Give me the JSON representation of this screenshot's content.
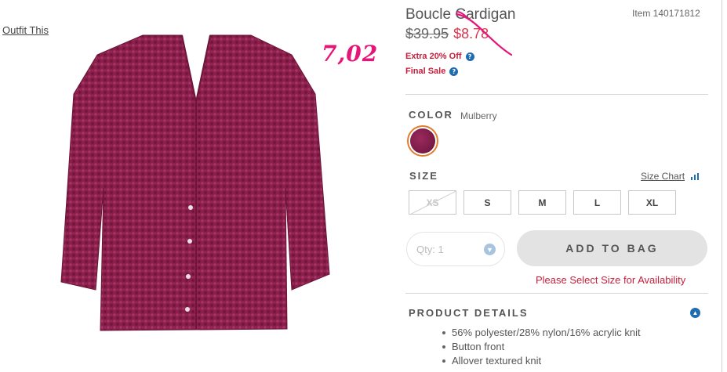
{
  "links": {
    "outfit": "Outfit This"
  },
  "annotation": {
    "handwritten_price": "7,02"
  },
  "product": {
    "title": "Boucle Cardigan",
    "item_number": "Item 140171812",
    "price_original": "$39.95",
    "price_sale": "$8.78",
    "promo_extra": "Extra 20% Off",
    "promo_final": "Final Sale"
  },
  "color": {
    "label": "COLOR",
    "value": "Mulberry",
    "swatch_hex": "#7d1c48"
  },
  "size": {
    "label": "SIZE",
    "chart_link": "Size Chart",
    "options": [
      {
        "label": "XS",
        "available": false
      },
      {
        "label": "S",
        "available": true
      },
      {
        "label": "M",
        "available": true
      },
      {
        "label": "L",
        "available": true
      },
      {
        "label": "XL",
        "available": true
      }
    ]
  },
  "purchase": {
    "qty_placeholder": "Qty: 1",
    "add_to_bag": "ADD TO BAG",
    "warning": "Please Select Size for Availability"
  },
  "details": {
    "label": "PRODUCT DETAILS",
    "items": [
      "56% polyester/28% nylon/16% acrylic knit",
      "Button front",
      "Allover textured knit"
    ]
  },
  "colors": {
    "accent_red": "#c5203c",
    "annotation_pink": "#e4167a",
    "info_blue": "#1f6db0"
  },
  "icons": {
    "info": "info-icon",
    "size_chart": "bar-chart-icon",
    "qty_dropdown": "chevron-down-icon",
    "details_toggle": "chevron-up-icon"
  }
}
